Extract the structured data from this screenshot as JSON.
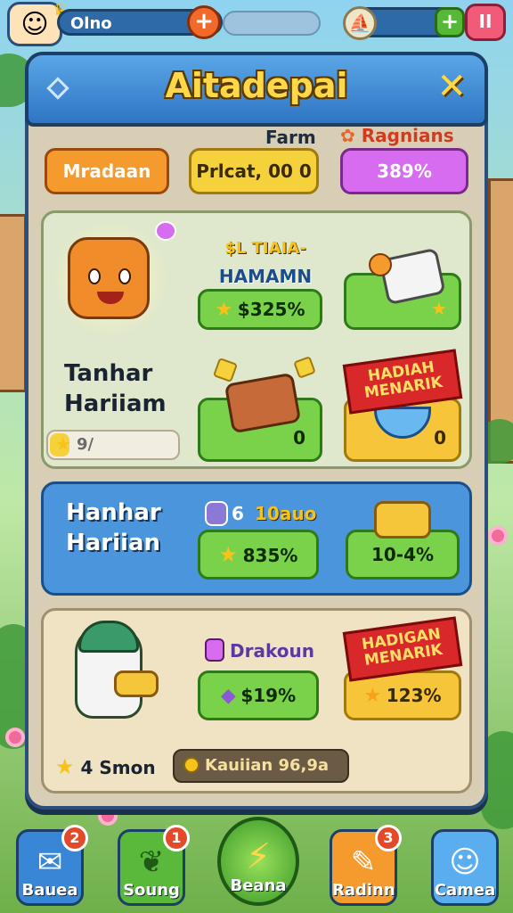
{
  "player": {
    "name": "Olno"
  },
  "topbar": {
    "plus_symbol": "+",
    "pause_symbol": "II"
  },
  "panel": {
    "title": "Aitadepai",
    "close_symbol": "✕",
    "farm_label": "Farm",
    "rank_label": "Ragnians"
  },
  "stats": {
    "pill1": "Mradaan",
    "pill2": "Prlcat, 00 0",
    "pill3": "389%"
  },
  "section1": {
    "event_title_1": "$L TIAIA-",
    "event_title_2": "HAMAMN",
    "event_button": "$325%",
    "label_line1": "Tanhar",
    "label_line2": "Hariiam",
    "progress_text": "9/",
    "progress_fraction": 0.15,
    "item1_count": "0",
    "ribbon_text": "HADIAH MENARIK",
    "item2_count": "0"
  },
  "section2": {
    "label_line1": "Hanhar",
    "label_line2": "Hariian",
    "header_count": "6",
    "header_text": "10auo",
    "button1": "835%",
    "button2": "10-4%"
  },
  "section3": {
    "badge_title": "Drakoun",
    "button1": "$19%",
    "ribbon_text": "HADIGAN MENARIK",
    "button2": "123%",
    "stars_text": "4 Smon",
    "coin_text": "Kauiian 96,9a"
  },
  "nav": [
    {
      "label": "Bauea",
      "badge": "2",
      "icon": "mail-icon"
    },
    {
      "label": "Soung",
      "badge": "1",
      "icon": "leaf-icon"
    },
    {
      "label": "Beana",
      "badge": "",
      "icon": "lightning-icon"
    },
    {
      "label": "Radinn",
      "badge": "3",
      "icon": "notepad-icon"
    },
    {
      "label": "Camea",
      "badge": "",
      "icon": "face-icon"
    }
  ],
  "colors": {
    "panel_blue": "#2f75c4",
    "title_gold": "#ffd84a",
    "button_green": "#7ad14a",
    "button_yellow": "#f7c53a",
    "ribbon_red": "#d8282a"
  }
}
